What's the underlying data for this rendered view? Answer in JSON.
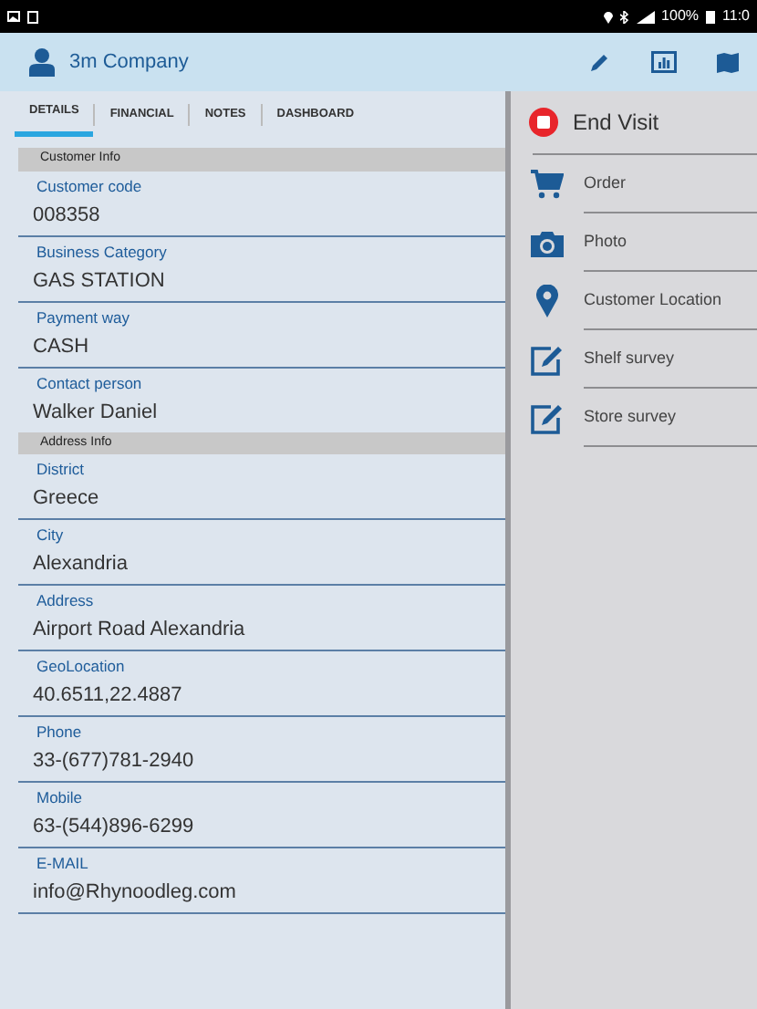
{
  "status_bar": {
    "battery": "100%",
    "time": "11:0"
  },
  "header": {
    "title": "3m Company"
  },
  "tabs": [
    {
      "label": "DETAILS",
      "selected": true
    },
    {
      "label": "FINANCIAL",
      "selected": false
    },
    {
      "label": "NOTES",
      "selected": false
    },
    {
      "label": "DASHBOARD",
      "selected": false
    }
  ],
  "sections": [
    {
      "title": "Customer Info",
      "fields": [
        {
          "label": "Customer code",
          "value": "008358"
        },
        {
          "label": "Business Category",
          "value": "GAS STATION"
        },
        {
          "label": "Payment way",
          "value": "CASH"
        },
        {
          "label": "Contact person",
          "value": "Walker Daniel"
        }
      ]
    },
    {
      "title": "Address Info",
      "fields": [
        {
          "label": "District",
          "value": "Greece"
        },
        {
          "label": "City",
          "value": "Alexandria"
        },
        {
          "label": "Address",
          "value": "Airport Road Alexandria"
        },
        {
          "label": "GeoLocation",
          "value": "40.6511,22.4887"
        },
        {
          "label": "Phone",
          "value": "33-(677)781-2940"
        },
        {
          "label": "Mobile",
          "value": "63-(544)896-6299"
        },
        {
          "label": "E-MAIL",
          "value": "info@Rhynoodleg.com"
        }
      ]
    }
  ],
  "end_visit": {
    "label": "End Visit"
  },
  "actions": [
    {
      "kind": "cart",
      "label": "Order"
    },
    {
      "kind": "camera",
      "label": "Photo"
    },
    {
      "kind": "pin",
      "label": "Customer Location"
    },
    {
      "kind": "edit",
      "label": "Shelf survey"
    },
    {
      "kind": "edit",
      "label": "Store survey"
    }
  ]
}
